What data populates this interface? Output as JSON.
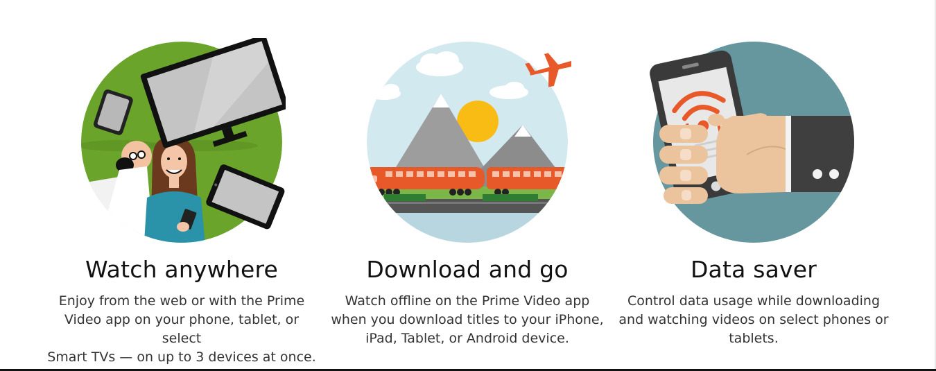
{
  "features": [
    {
      "title": "Watch anywhere",
      "description_lines": [
        "Enjoy from the web or with the Prime",
        "Video app on your phone, tablet, or select",
        "Smart TVs — on up to 3 devices at once."
      ],
      "illustration_icon": "watch-anywhere-illustration-icon",
      "circle_color": "#6aa42a"
    },
    {
      "title": "Download and go",
      "description_lines": [
        "Watch offline on the Prime Video app",
        "when you download titles to your iPhone,",
        "iPad, Tablet, or Android device."
      ],
      "illustration_icon": "download-and-go-illustration-icon",
      "circle_color": "#cfe7ef"
    },
    {
      "title": "Data saver",
      "description_lines": [
        "Control data usage while downloading",
        "and watching videos on select phones or",
        "tablets."
      ],
      "illustration_icon": "data-saver-illustration-icon",
      "circle_color": "#66969e"
    }
  ],
  "colors": {
    "accent_orange": "#e8592a",
    "sun_yellow": "#f9bc15",
    "text_dark": "#111111",
    "text_body": "#333333"
  }
}
